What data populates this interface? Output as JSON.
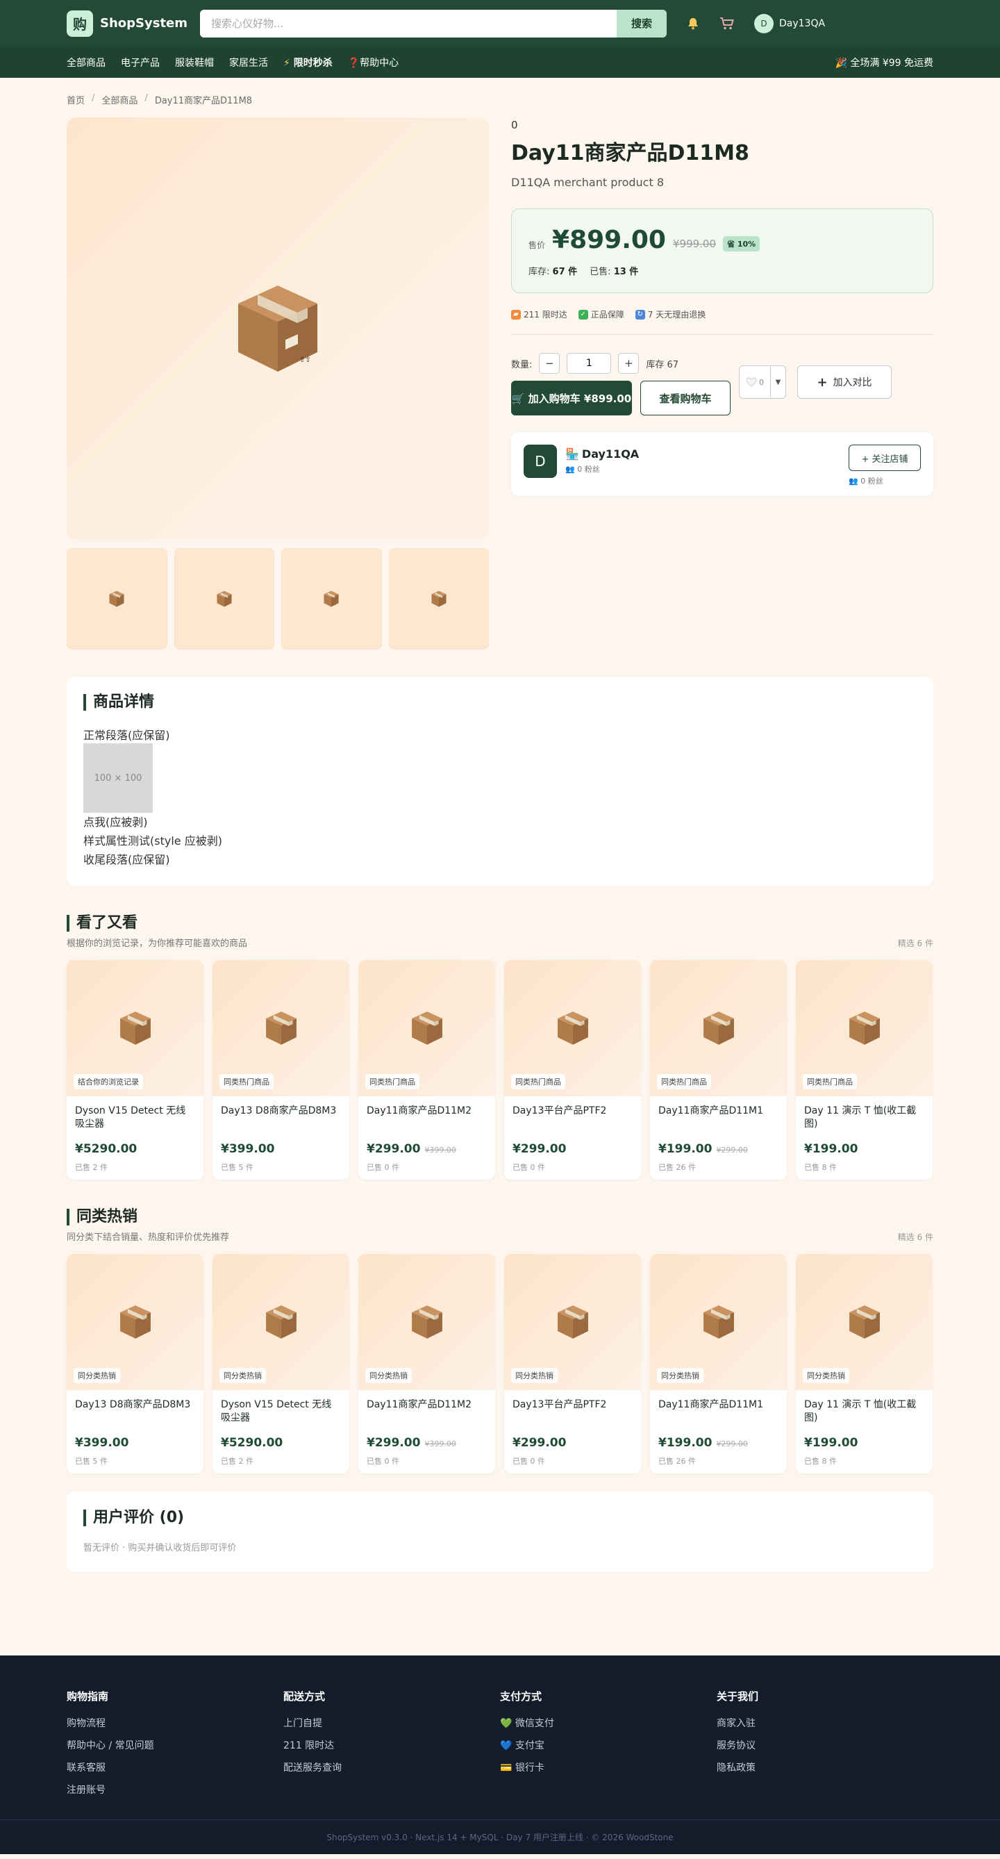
{
  "header": {
    "logo_char": "购",
    "brand": "ShopSystem",
    "search_placeholder": "搜索心仪好物...",
    "search_button": "搜索",
    "user_initial": "D",
    "user_name": "Day13QA"
  },
  "nav": {
    "items": [
      "全部商品",
      "电子产品",
      "服装鞋帽",
      "家居生活"
    ],
    "flash": "限时秒杀",
    "help": "帮助中心",
    "promo": "🎉 全场满 ¥99 免运费"
  },
  "breadcrumb": [
    "首页",
    "全部商品",
    "Day11商家产品D11M8"
  ],
  "product": {
    "brand_num": "0",
    "title": "Day11商家产品D11M8",
    "subtitle": "D11QA merchant product 8",
    "price_label": "售价",
    "price": "¥899.00",
    "original_price": "¥999.00",
    "discount": "省 10%",
    "stock_label": "库存:",
    "stock_value": "67 件",
    "sold_label": "已售:",
    "sold_value": "13 件",
    "badges": [
      "211 限时达",
      "正品保障",
      "7 天无理由退换"
    ],
    "qty_label": "数量:",
    "qty_value": "1",
    "qty_stock": "库存 67",
    "add_cart": "🛒 加入购物车 ¥899.00",
    "view_cart": "查看购物车",
    "fav_count": "0",
    "compare": "加入对比"
  },
  "shop": {
    "initial": "D",
    "name": "Day11QA",
    "fans": "👥 0 粉丝",
    "follow": "+ 关注店铺",
    "fans_right": "👥 0 粉丝"
  },
  "detail": {
    "heading": "商品详情",
    "p1": "正常段落(应保留)",
    "img_text": "100 × 100",
    "p2": "点我(应被剥)",
    "p3": "样式属性测试(style 应被剥)",
    "p4": "收尾段落(应保留)"
  },
  "rec1": {
    "title": "看了又看",
    "subtitle": "根据你的浏览记录，为你推荐可能喜欢的商品",
    "count": "精选 6 件",
    "items": [
      {
        "tag": "结合你的浏览记录",
        "name": "Dyson V15 Detect 无线吸尘器",
        "price": "¥5290.00",
        "old": "",
        "sold": "已售 2 件"
      },
      {
        "tag": "同类热门商品",
        "name": "Day13 D8商家产品D8M3",
        "price": "¥399.00",
        "old": "",
        "sold": "已售 5 件"
      },
      {
        "tag": "同类热门商品",
        "name": "Day11商家产品D11M2",
        "price": "¥299.00",
        "old": "¥399.00",
        "sold": "已售 0 件"
      },
      {
        "tag": "同类热门商品",
        "name": "Day13平台产品PTF2",
        "price": "¥299.00",
        "old": "",
        "sold": "已售 0 件"
      },
      {
        "tag": "同类热门商品",
        "name": "Day11商家产品D11M1",
        "price": "¥199.00",
        "old": "¥299.00",
        "sold": "已售 26 件"
      },
      {
        "tag": "同类热门商品",
        "name": "Day 11 演示 T 恤(收工截图)",
        "price": "¥199.00",
        "old": "",
        "sold": "已售 8 件"
      }
    ]
  },
  "rec2": {
    "title": "同类热销",
    "subtitle": "同分类下结合销量、热度和评价优先推荐",
    "count": "精选 6 件",
    "items": [
      {
        "tag": "同分类热销",
        "name": "Day13 D8商家产品D8M3",
        "price": "¥399.00",
        "old": "",
        "sold": "已售 5 件"
      },
      {
        "tag": "同分类热销",
        "name": "Dyson V15 Detect 无线吸尘器",
        "price": "¥5290.00",
        "old": "",
        "sold": "已售 2 件"
      },
      {
        "tag": "同分类热销",
        "name": "Day11商家产品D11M2",
        "price": "¥299.00",
        "old": "¥399.00",
        "sold": "已售 0 件"
      },
      {
        "tag": "同分类热销",
        "name": "Day13平台产品PTF2",
        "price": "¥299.00",
        "old": "",
        "sold": "已售 0 件"
      },
      {
        "tag": "同分类热销",
        "name": "Day11商家产品D11M1",
        "price": "¥199.00",
        "old": "¥299.00",
        "sold": "已售 26 件"
      },
      {
        "tag": "同分类热销",
        "name": "Day 11 演示 T 恤(收工截图)",
        "price": "¥199.00",
        "old": "",
        "sold": "已售 8 件"
      }
    ]
  },
  "reviews": {
    "heading": "用户评价 (0)",
    "hint": "暂无评价 · 购买并确认收货后即可评价"
  },
  "footer": {
    "cols": [
      {
        "title": "购物指南",
        "links": [
          "购物流程",
          "帮助中心 / 常见问题",
          "联系客服",
          "注册账号"
        ]
      },
      {
        "title": "配送方式",
        "links": [
          "上门自提",
          "211 限时达",
          "配送服务查询"
        ]
      },
      {
        "title": "支付方式",
        "links": [
          "💚 微信支付",
          "💙 支付宝",
          "💳 银行卡"
        ]
      },
      {
        "title": "关于我们",
        "links": [
          "商家入驻",
          "服务协议",
          "隐私政策"
        ]
      }
    ],
    "bottom": "ShopSystem v0.3.0 · Next.js 14 + MySQL · Day 7 用户注册上线 · © 2026 WoodStone"
  },
  "colors": {
    "primary": "#234a36",
    "nav_dark": "#1e4330",
    "accent_light": "#b9e4c9",
    "page_bg": "#fdf6ee",
    "footer_bg": "#141b2b"
  },
  "icons": {
    "bell": "bell-icon",
    "cart": "cart-icon",
    "box": "package-box-icon",
    "chat": "chat-bubble-icon"
  }
}
